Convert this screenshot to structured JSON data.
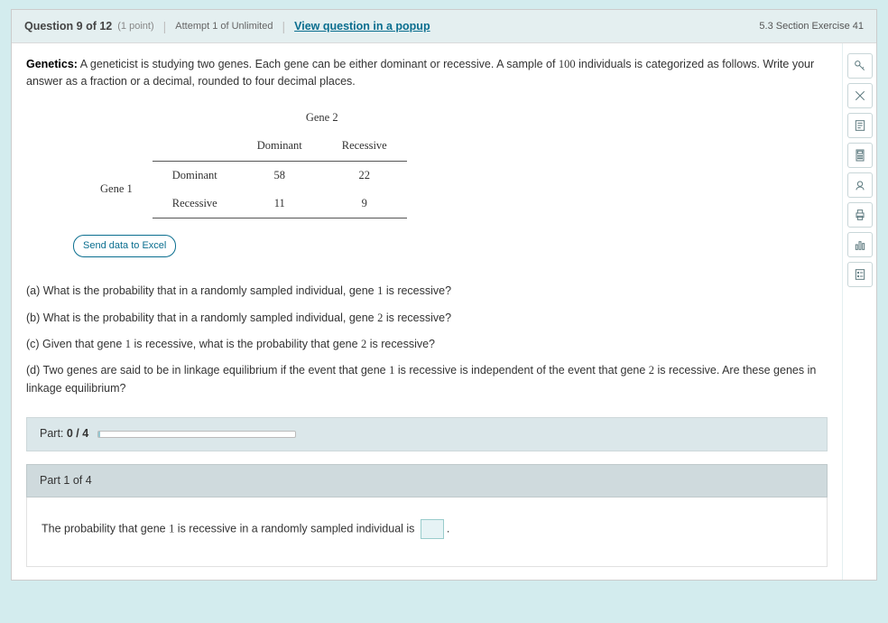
{
  "header": {
    "question_label": "Question 9 of 12",
    "points": "(1 point)",
    "attempt": "Attempt 1 of Unlimited",
    "popup_link": "View question in a popup",
    "section": "5.3 Section Exercise 41"
  },
  "prompt": {
    "title": "Genetics:",
    "text_1": " A geneticist is studying two genes. Each gene can be either dominant or recessive. A sample of ",
    "sample_n": "100",
    "text_2": " individuals is categorized as follows. Write your answer as a fraction or a decimal, rounded to four decimal places."
  },
  "table": {
    "top_title": "Gene 2",
    "left_title": "Gene 1",
    "cols": [
      "Dominant",
      "Recessive"
    ],
    "rows": [
      {
        "label": "Dominant",
        "vals": [
          "58",
          "22"
        ]
      },
      {
        "label": "Recessive",
        "vals": [
          "11",
          "9"
        ]
      }
    ]
  },
  "send_excel": "Send data to Excel",
  "questions": {
    "a_pre": "(a) What is the probability that in a randomly sampled individual, gene ",
    "a_num": "1",
    "a_post": " is recessive?",
    "b_pre": "(b) What is the probability that in a randomly sampled individual, gene ",
    "b_num": "2",
    "b_post": " is recessive?",
    "c_pre": "(c) Given that gene ",
    "c_n1": "1",
    "c_mid": " is recessive, what is the probability that gene ",
    "c_n2": "2",
    "c_post": " is recessive?",
    "d_pre": "(d) Two genes are said to be in linkage equilibrium if the event that gene ",
    "d_n1": "1",
    "d_mid": " is recessive is independent of the event that gene ",
    "d_n2": "2",
    "d_post": " is recessive. Are these genes in linkage equilibrium?"
  },
  "progress": {
    "label_pre": "Part: ",
    "label_val": "0 / 4"
  },
  "part1": {
    "title": "Part 1 of 4",
    "text_pre": "The probability that gene ",
    "num": "1",
    "text_post": " is recessive in a randomly sampled individual is ",
    "period": "."
  },
  "toolbar_names": [
    "key-icon",
    "nav-icon",
    "notes-icon",
    "calculator-icon",
    "view-icon",
    "print-icon",
    "stats-icon",
    "settings-icon"
  ]
}
